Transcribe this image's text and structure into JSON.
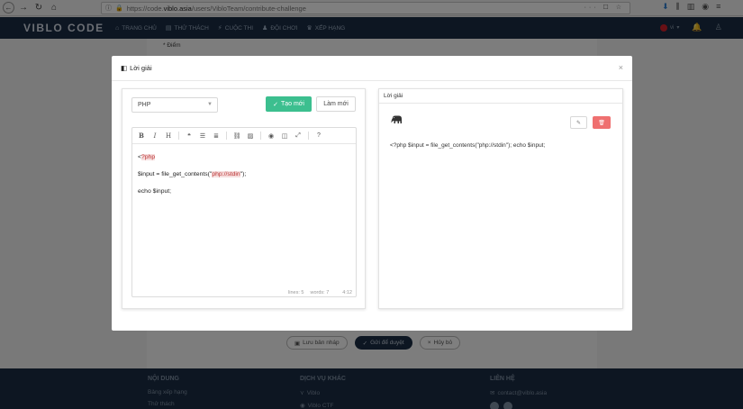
{
  "browser": {
    "url_prefix": "https://code.",
    "url_domain": "viblo.asia",
    "url_path": "/users/VibloTeam/contribute-challenge",
    "url_actions": "··· ☐ ☆"
  },
  "site": {
    "logo": "VIBLO CODE",
    "menu": [
      {
        "icon": "⌂",
        "label": "TRANG CHỦ"
      },
      {
        "icon": "▤",
        "label": "THỬ THÁCH"
      },
      {
        "icon": "⚡",
        "label": "CUỘC THI"
      },
      {
        "icon": "♟",
        "label": "ĐỘI CHƠI"
      },
      {
        "icon": "♛",
        "label": "XẾP HẠNG"
      }
    ],
    "lang": "vi"
  },
  "background_page": {
    "field_label": "* Điểm",
    "actions": {
      "save_draft": "Lưu bản nháp",
      "submit": "Gửi để duyệt",
      "cancel": "Hủy bỏ"
    }
  },
  "footer": {
    "col1": {
      "title": "NỘI DUNG",
      "links": [
        "Bảng xếp hạng",
        "Thử thách"
      ]
    },
    "col2": {
      "title": "DỊCH VỤ KHÁC",
      "links": [
        "Viblo",
        "Viblo CTF"
      ]
    },
    "col3": {
      "title": "LIÊN HỆ",
      "email": "contact@viblo.asia"
    }
  },
  "modal": {
    "title": "Lời giải",
    "close": "×",
    "left": {
      "language": "PHP",
      "create_label": "Tạo mới",
      "reset_label": "Làm mới",
      "toolbar": {
        "bold": "B",
        "italic": "I",
        "heading": "H",
        "quote": "❝",
        "help": "?"
      },
      "code_lines": [
        {
          "before": "<",
          "highlight": "?php",
          "after": ""
        },
        {
          "before": "",
          "highlight": "",
          "after": ""
        },
        {
          "before": "$input = file_get_contents(\"",
          "highlight": "php://stdin",
          "after": "\");"
        },
        {
          "before": "",
          "highlight": "",
          "after": ""
        },
        {
          "before": "echo $input;",
          "highlight": "",
          "after": ""
        }
      ],
      "status": {
        "lines": "lines: 5",
        "words": "words: 7",
        "cursor": "4:12"
      }
    },
    "right": {
      "title": "Lời giải",
      "language_icon": "elephant-icon",
      "output": "<?php $input = file_get_contents(\"php://stdin\"); echo $input;"
    }
  },
  "colors": {
    "header": "#1b2d44",
    "primary": "#3cbf8f",
    "danger": "#ef7070"
  }
}
